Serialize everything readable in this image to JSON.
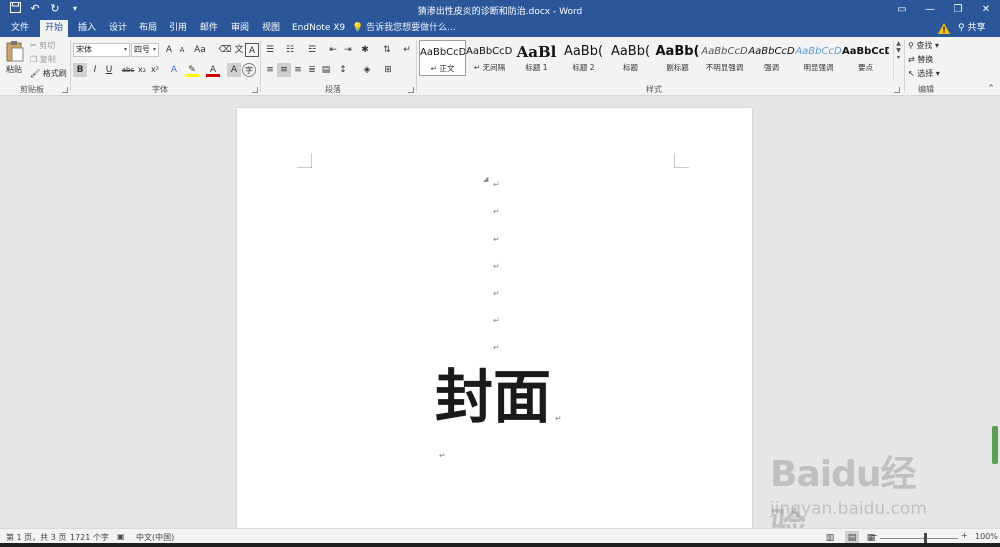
{
  "titlebar": {
    "doc_title": "猜渗出性皮炎的诊断和防治.docx - Word",
    "qat": [
      "save-icon",
      "undo-icon",
      "redo-icon",
      "customize-icon"
    ]
  },
  "tabs": [
    {
      "label": "文件",
      "name": "tab-file"
    },
    {
      "label": "开始",
      "name": "tab-home",
      "active": true
    },
    {
      "label": "插入",
      "name": "tab-insert"
    },
    {
      "label": "设计",
      "name": "tab-design"
    },
    {
      "label": "布局",
      "name": "tab-layout"
    },
    {
      "label": "引用",
      "name": "tab-references"
    },
    {
      "label": "邮件",
      "name": "tab-mailings"
    },
    {
      "label": "审阅",
      "name": "tab-review"
    },
    {
      "label": "视图",
      "name": "tab-view"
    },
    {
      "label": "EndNote X9",
      "name": "tab-endnote"
    }
  ],
  "tellme": "告诉我您想要做什么...",
  "share_label": "共享",
  "ribbon": {
    "clipboard": {
      "group_label": "剪贴板",
      "paste": "粘贴",
      "cut": "剪切",
      "copy": "复制",
      "format_painter": "格式刷"
    },
    "font": {
      "group_label": "字体",
      "font_name": "宋体",
      "font_size": "四号",
      "grow": "A",
      "shrink": "A",
      "change_case": "Aa",
      "bold": "B",
      "italic": "I",
      "underline": "U",
      "strike": "abc",
      "subscript": "x₂",
      "superscript": "x²"
    },
    "paragraph": {
      "group_label": "段落"
    },
    "styles": {
      "group_label": "样式",
      "items": [
        {
          "sample": "AaBbCcDc",
          "name": "↵ 正文",
          "selected": true
        },
        {
          "sample": "AaBbCcDc",
          "name": "↵ 无间隔"
        },
        {
          "sample": "AaBl",
          "name": "标题 1"
        },
        {
          "sample": "AaBb(",
          "name": "标题 2"
        },
        {
          "sample": "AaBb(",
          "name": "标题"
        },
        {
          "sample": "AaBb(",
          "name": "副标题"
        },
        {
          "sample": "AaBbCcD",
          "name": "不明显强调"
        },
        {
          "sample": "AaBbCcD",
          "name": "强调"
        },
        {
          "sample": "AaBbCcD",
          "name": "明显强调"
        },
        {
          "sample": "AaBbCcD",
          "name": "要点"
        }
      ]
    },
    "editing": {
      "group_label": "编辑",
      "find": "查找",
      "replace": "替换",
      "select": "选择"
    }
  },
  "document": {
    "cover_text": "封面",
    "paragraph_mark": "↵"
  },
  "statusbar": {
    "page": "第 1 页，共 3 页",
    "words": "1721 个字",
    "language": "中文(中国)",
    "zoom": "100%"
  },
  "watermark": {
    "brand": "Baidu经验",
    "url": "jingyan.baidu.com"
  },
  "colors": {
    "word_blue": "#2b579a",
    "ribbon_bg": "#f3f3f3",
    "canvas_bg": "#e6e6e6"
  }
}
